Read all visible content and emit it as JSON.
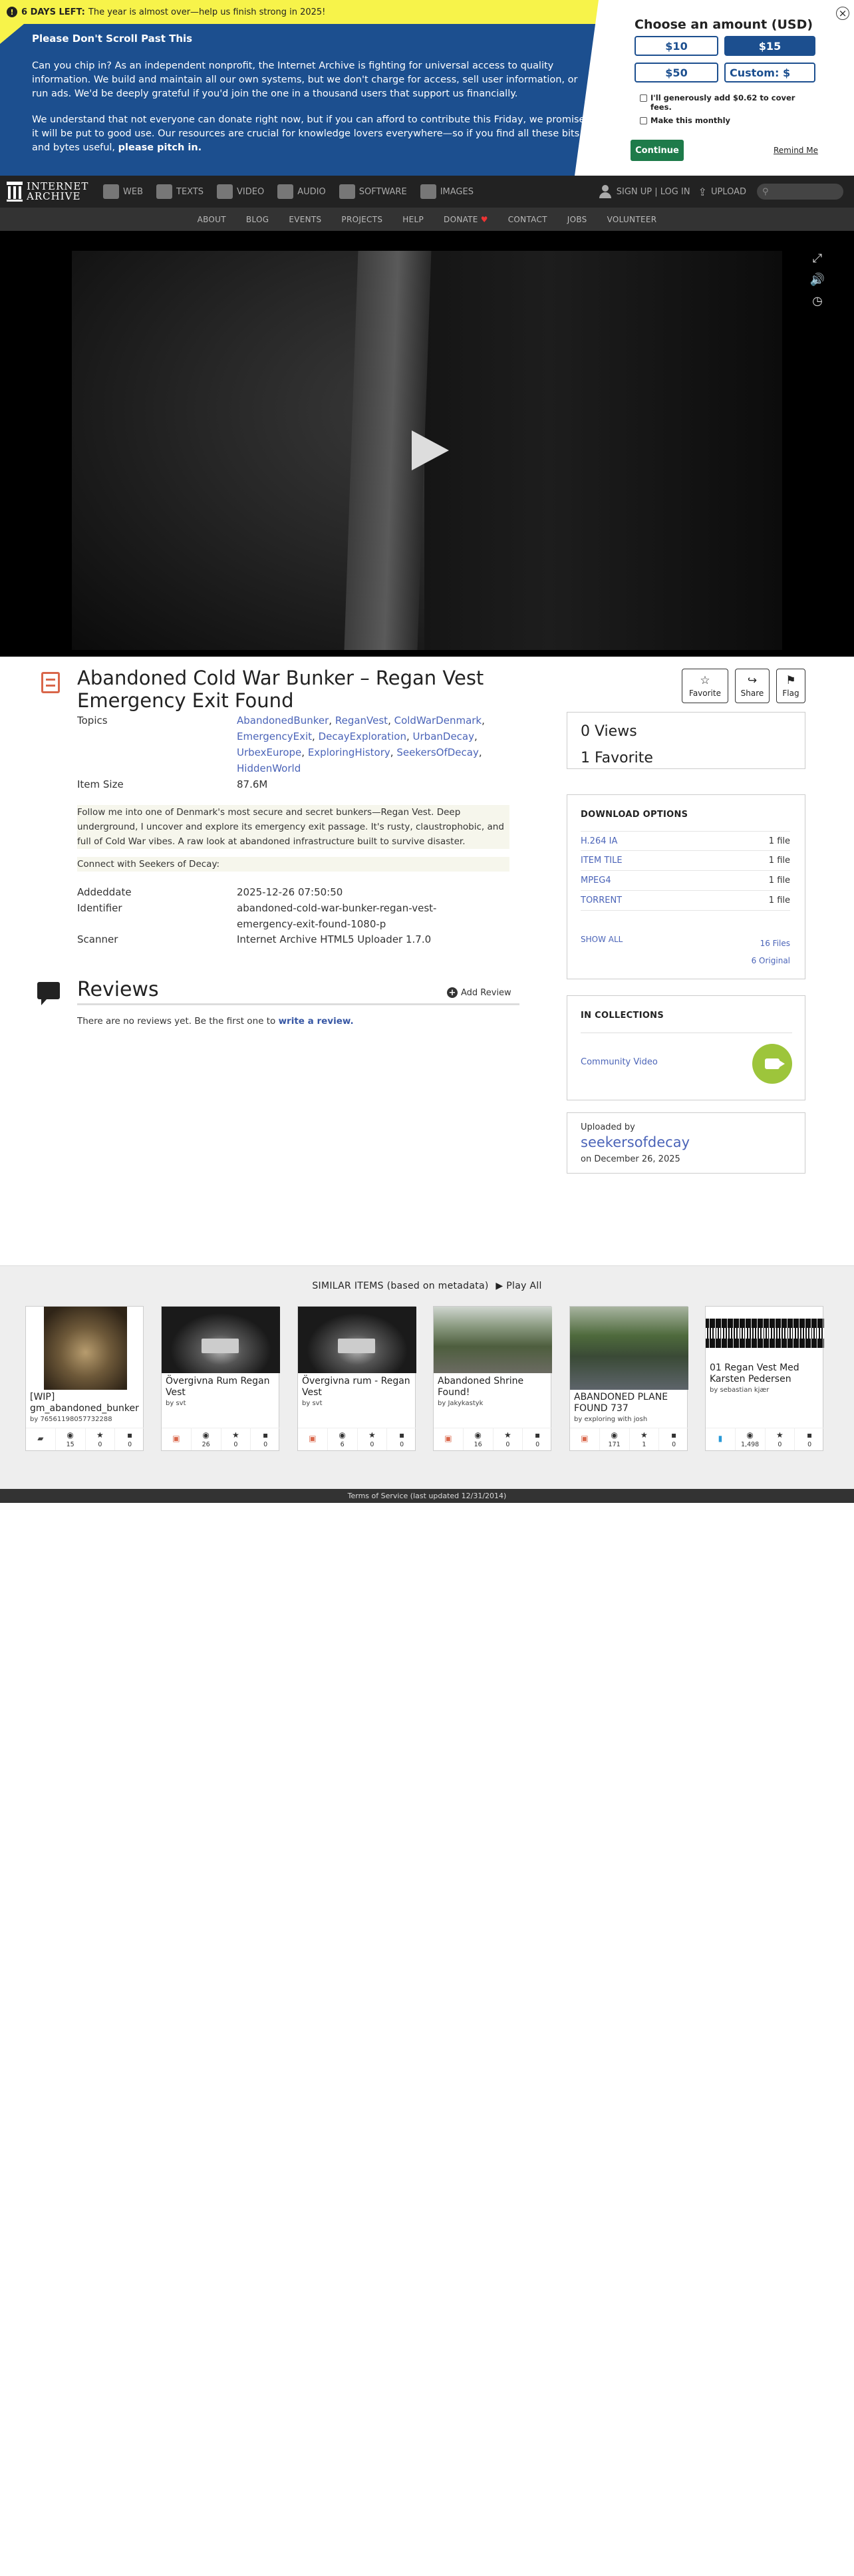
{
  "donation": {
    "days_left_label": "6 DAYS LEFT:",
    "days_left_text": "The year is almost over—help us finish strong in 2025!",
    "heading": "Please Don't Scroll Past This",
    "para1": "Can you chip in? As an independent nonprofit, the Internet Archive is fighting for universal access to quality information. We build and maintain all our own systems, but we don't charge for access, sell user information, or run ads. We'd be deeply grateful if you'd join the one in a thousand users that support us financially.",
    "para2": "We understand that not everyone can donate right now, but if you can afford to contribute this Friday, we promise it will be put to good use. Our resources are crucial for knowledge lovers everywhere—so if you find all these bits and bytes useful,",
    "pitch": "please pitch in.",
    "panel_title": "Choose an amount (USD)",
    "amounts": [
      "$10",
      "$15",
      "$50",
      "Custom: $"
    ],
    "fees_label": "I'll generously add $0.62 to cover fees.",
    "monthly_label": "Make this monthly",
    "continue": "Continue",
    "remind": "Remind Me",
    "close": "×"
  },
  "topnav": {
    "logo_line1": "INTERNET",
    "logo_line2": "ARCHIVE",
    "items": [
      "WEB",
      "TEXTS",
      "VIDEO",
      "AUDIO",
      "SOFTWARE",
      "IMAGES"
    ],
    "signin": "SIGN UP | LOG IN",
    "upload": "UPLOAD",
    "search_glyph": "⚲"
  },
  "subnav": [
    "ABOUT",
    "BLOG",
    "EVENTS",
    "PROJECTS",
    "HELP",
    "DONATE",
    "CONTACT",
    "JOBS",
    "VOLUNTEER"
  ],
  "item": {
    "title": "Abandoned Cold War Bunker – Regan Vest Emergency Exit Found",
    "favorite": "Favorite",
    "share": "Share",
    "flag": "Flag",
    "topics_label": "Topics",
    "topics": [
      "AbandonedBunker",
      "ReganVest",
      "ColdWarDenmark",
      "EmergencyExit",
      "DecayExploration",
      "UrbanDecay",
      "UrbexEurope",
      "ExploringHistory",
      "SeekersOfDecay",
      "HiddenWorld"
    ],
    "item_size_label": "Item Size",
    "item_size": "87.6M",
    "description": "Follow me into one of Denmark's most secure and secret bunkers—Regan Vest. Deep underground, I uncover and explore its emergency exit passage. It's rusty, claustrophobic, and full of Cold War vibes. A raw look at abandoned infrastructure built to survive disaster.",
    "connect": "Connect with Seekers of Decay:",
    "addeddate_label": "Addeddate",
    "addeddate": "2025-12-26 07:50:50",
    "identifier_label": "Identifier",
    "identifier": "abandoned-cold-war-bunker-regan-vest-emergency-exit-found-1080-p",
    "scanner_label": "Scanner",
    "scanner": "Internet Archive HTML5 Uploader 1.7.0"
  },
  "reviews": {
    "title": "Reviews",
    "add": "Add Review",
    "none_text": "There are no reviews yet. Be the first one to",
    "write_link": "write a review."
  },
  "stats": {
    "views": "0 Views",
    "favorites": "1 Favorite"
  },
  "downloads": {
    "title": "DOWNLOAD OPTIONS",
    "rows": [
      {
        "format": "H.264 IA",
        "count": "1 file"
      },
      {
        "format": "ITEM TILE",
        "count": "1 file"
      },
      {
        "format": "MPEG4",
        "count": "1 file"
      },
      {
        "format": "TORRENT",
        "count": "1 file"
      }
    ],
    "show_all": "SHOW ALL",
    "total_files": "16 Files",
    "original": "6 Original"
  },
  "collections": {
    "title": "IN COLLECTIONS",
    "name": "Community Video"
  },
  "uploader": {
    "label": "Uploaded by",
    "name": "seekersofdecay",
    "date": "on December 26, 2025"
  },
  "similar": {
    "header": "SIMILAR ITEMS (based on metadata)",
    "play_all": "Play All",
    "cards": [
      {
        "title": "[WIP] gm_abandoned_bunker",
        "by": "by 76561198057732288",
        "type": "folder",
        "views": "15",
        "favs": "0",
        "reviews": "0"
      },
      {
        "title": "Övergivna Rum Regan Vest",
        "by": "by svt",
        "type": "film",
        "views": "26",
        "favs": "0",
        "reviews": "0"
      },
      {
        "title": "Övergivna rum - Regan Vest",
        "by": "by svt",
        "type": "film",
        "views": "6",
        "favs": "0",
        "reviews": "0"
      },
      {
        "title": "Abandoned Shrine Found!",
        "by": "by Jakykastyk",
        "type": "film",
        "views": "16",
        "favs": "0",
        "reviews": "0"
      },
      {
        "title": "ABANDONED PLANE FOUND 737",
        "by": "by exploring with josh",
        "type": "film",
        "views": "171",
        "favs": "1",
        "reviews": "0"
      },
      {
        "title": "01 Regan Vest Med Karsten Pedersen",
        "by": "by sebastian kjær",
        "type": "audio",
        "views": "1,498",
        "favs": "0",
        "reviews": "0"
      }
    ]
  },
  "footer": "Terms of Service (last updated 12/31/2014)"
}
